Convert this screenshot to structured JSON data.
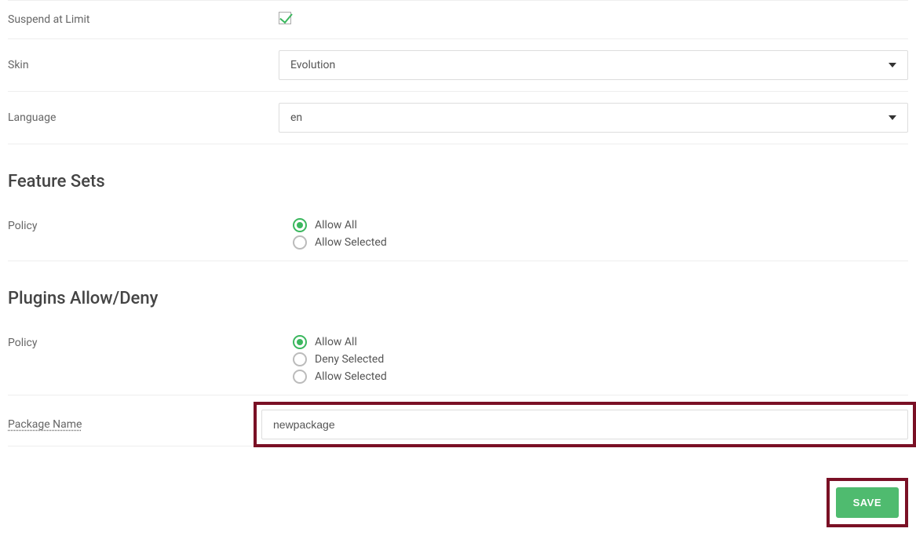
{
  "fields": {
    "suspend_at_limit": {
      "label": "Suspend at Limit",
      "checked": true
    },
    "skin": {
      "label": "Skin",
      "value": "Evolution"
    },
    "language": {
      "label": "Language",
      "value": "en"
    }
  },
  "feature_sets": {
    "heading": "Feature Sets",
    "policy_label": "Policy",
    "options": {
      "allow_all": "Allow All",
      "allow_selected": "Allow Selected"
    },
    "selected": "allow_all"
  },
  "plugins": {
    "heading": "Plugins Allow/Deny",
    "policy_label": "Policy",
    "options": {
      "allow_all": "Allow All",
      "deny_selected": "Deny Selected",
      "allow_selected": "Allow Selected"
    },
    "selected": "allow_all"
  },
  "package_name": {
    "label": "Package Name",
    "value": "newpackage"
  },
  "save_button": "SAVE"
}
